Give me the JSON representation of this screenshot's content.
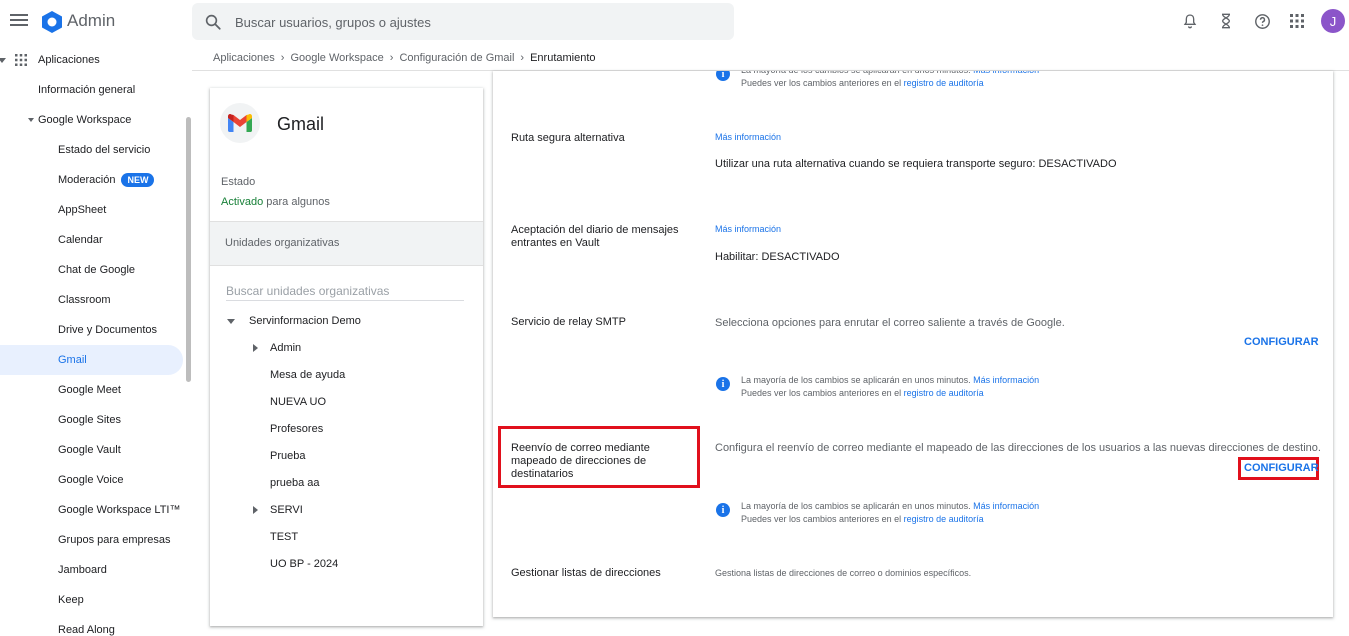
{
  "topbar": {
    "app_name": "Admin",
    "search_placeholder": "Buscar usuarios, grupos o ajustes",
    "avatar_letter": "J"
  },
  "sidebar": {
    "root": "Aplicaciones",
    "items": [
      {
        "label": "Información general"
      },
      {
        "label": "Google Workspace"
      },
      {
        "label": "Estado del servicio"
      },
      {
        "label": "Moderación",
        "badge": "NEW"
      },
      {
        "label": "AppSheet"
      },
      {
        "label": "Calendar"
      },
      {
        "label": "Chat de Google"
      },
      {
        "label": "Classroom"
      },
      {
        "label": "Drive y Documentos"
      },
      {
        "label": "Gmail"
      },
      {
        "label": "Google Meet"
      },
      {
        "label": "Google Sites"
      },
      {
        "label": "Google Vault"
      },
      {
        "label": "Google Voice"
      },
      {
        "label": "Google Workspace LTI™"
      },
      {
        "label": "Grupos para empresas"
      },
      {
        "label": "Jamboard"
      },
      {
        "label": "Keep"
      },
      {
        "label": "Read Along"
      }
    ]
  },
  "breadcrumb": {
    "items": [
      "Aplicaciones",
      "Google Workspace",
      "Configuración de Gmail",
      "Enrutamiento"
    ]
  },
  "left_panel": {
    "title": "Gmail",
    "status_label": "Estado",
    "status_value": "Activado",
    "status_suffix": " para algunos",
    "ou_header": "Unidades organizativas",
    "ou_search_placeholder": "Buscar unidades organizativas",
    "ou_root": "Servinformacion Demo",
    "ou_items": [
      "Admin",
      "Mesa de ayuda",
      "NUEVA UO",
      "Profesores",
      "Prueba",
      "prueba aa",
      "SERVI",
      "TEST",
      "UO BP - 2024"
    ]
  },
  "right_panel": {
    "info_line1": "La mayoría de los cambios se aplicarán en unos minutos.",
    "info_link1": "Más información",
    "info_line2": "Puedes ver los cambios anteriores en el",
    "info_link2": "registro de auditoría",
    "learn_more": "Más información",
    "settings": [
      {
        "label": "Ruta segura alternativa",
        "value_text": "Utilizar una ruta alternativa cuando se requiera transporte seguro: ",
        "value_state": "DESACTIVADO"
      },
      {
        "label": "Aceptación del diario de mensajes entrantes en Vault",
        "value_text": "Habilitar: ",
        "value_state": "DESACTIVADO"
      },
      {
        "label": "Servicio de relay SMTP",
        "description": "Selecciona opciones para enrutar el correo saliente a través de Google.",
        "button": "CONFIGURAR"
      },
      {
        "label": "Reenvío de correo mediante mapeado de direcciones de destinatarios",
        "description": "Configura el reenvío de correo mediante el mapeado de las direcciones de los usuarios a las nuevas direcciones de destino.",
        "button": "CONFIGURAR"
      },
      {
        "label": "Gestionar listas de direcciones",
        "description": "Gestiona listas de direcciones de correo o dominios específicos."
      }
    ]
  },
  "colors": {
    "accent": "#1a73e8",
    "highlight": "#e1101c",
    "status_green": "#188038",
    "avatar": "#8b55c9"
  },
  "icons": [
    "menu-icon",
    "admin-logo-icon",
    "search-icon",
    "bell-icon",
    "hourglass-icon",
    "help-icon",
    "apps-grid-icon",
    "gmail-logo-icon",
    "info-icon"
  ]
}
